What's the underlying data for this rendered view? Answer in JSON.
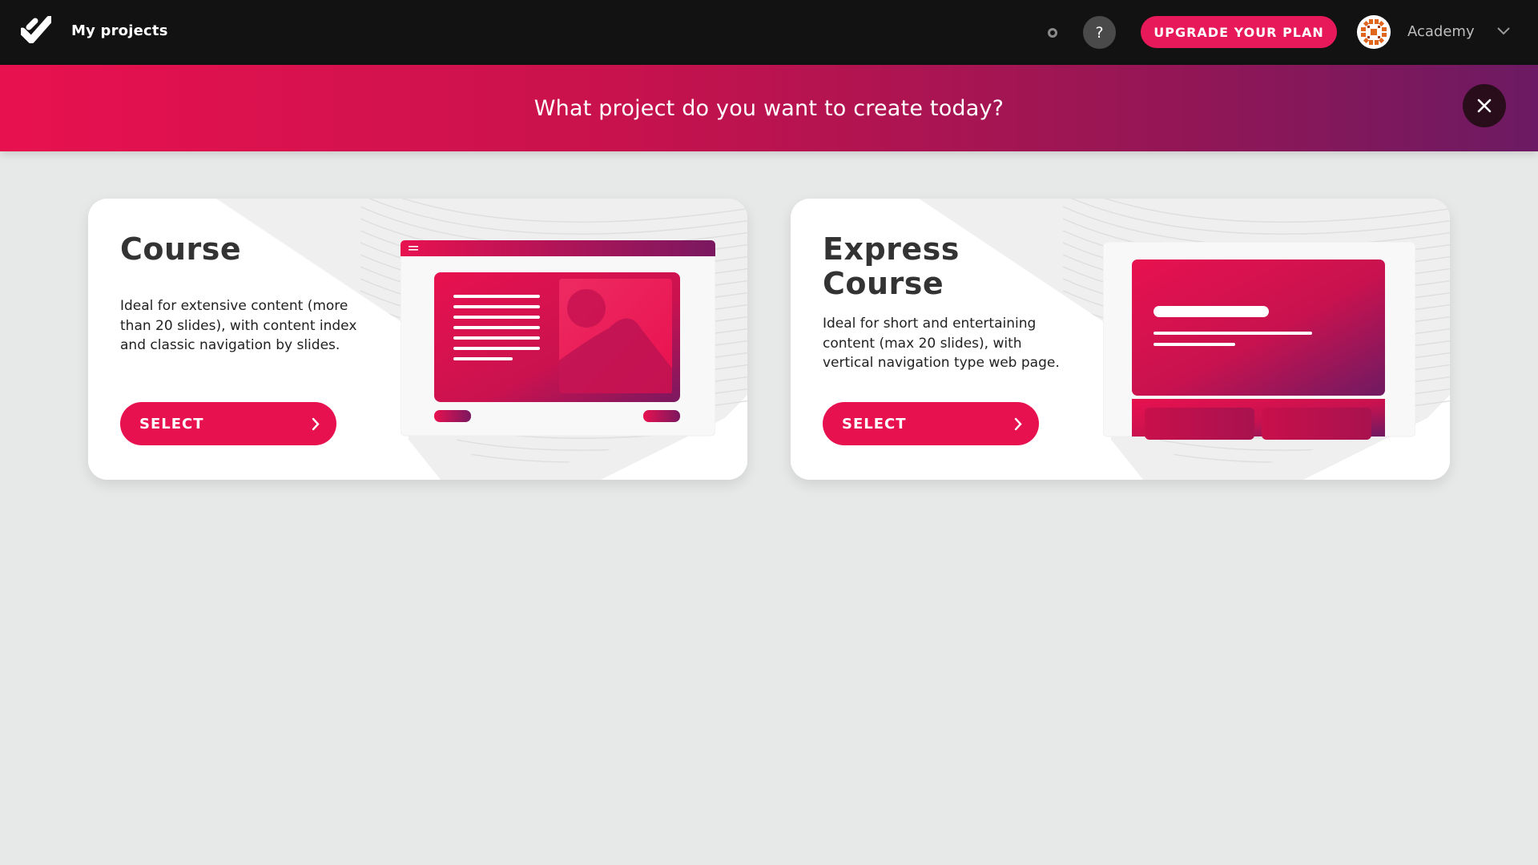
{
  "header": {
    "nav_title": "My projects",
    "help_label": "?",
    "upgrade_label": "UPGRADE YOUR PLAN",
    "account_name": "Academy",
    "icons": [
      "check-logo-icon",
      "status-dot-icon",
      "help-icon",
      "avatar",
      "chevron-down-icon"
    ]
  },
  "banner": {
    "title": "What project do you want to create today?",
    "close_icon": "close-icon"
  },
  "cards": [
    {
      "title": "Course",
      "description": "Ideal for extensive content (more than 20 slides), with content index and classic navigation by slides.",
      "button_label": "SELECT"
    },
    {
      "title": "Express Course",
      "description": "Ideal for short and entertaining content (max 20 slides), with vertical navigation type web page.",
      "button_label": "SELECT"
    }
  ],
  "colors": {
    "accent": "#e8114f",
    "banner_start": "#e8114f",
    "banner_end": "#6c1a63",
    "topbar": "#121212",
    "background": "#e7e8e8"
  }
}
